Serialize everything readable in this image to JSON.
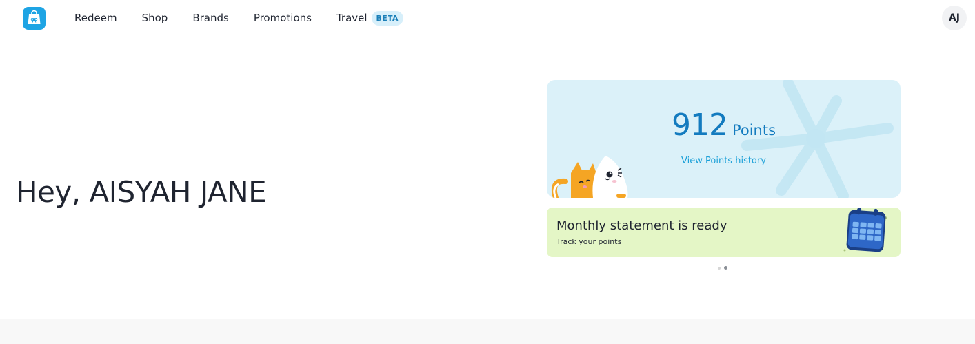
{
  "header": {
    "logo_icon": "gift-bag-icon",
    "brand_color": "#1ea4e4",
    "nav": [
      {
        "label": "Redeem"
      },
      {
        "label": "Shop"
      },
      {
        "label": "Brands"
      },
      {
        "label": "Promotions"
      },
      {
        "label": "Travel",
        "badge": "BETA"
      }
    ],
    "avatar_initials": "AJ"
  },
  "greeting": "Hey, AISYAH JANE",
  "points_card": {
    "value": "912",
    "unit": "Points",
    "link": "View Points history",
    "background": "#dbf1f9",
    "accent": "#137bbf",
    "decoration_icons": [
      "ribbon-bow-icon",
      "cats-illustration-icon"
    ]
  },
  "statement_card": {
    "title": "Monthly statement is ready",
    "subtitle": "Track your points",
    "background": "#e4f6c6",
    "icon": "calendar-icon"
  },
  "carousel": {
    "dot_count": 2,
    "active_index": 1
  }
}
